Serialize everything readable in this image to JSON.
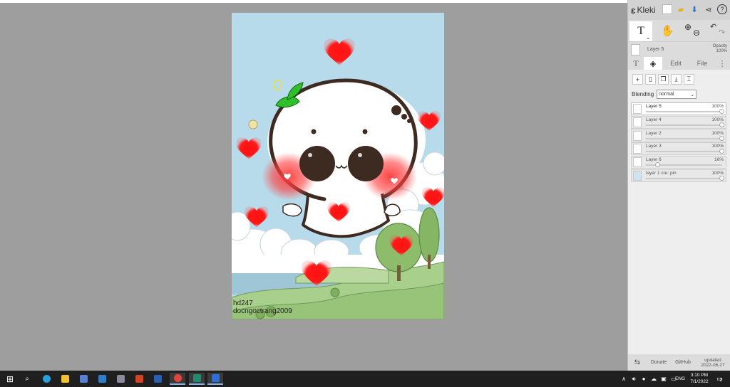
{
  "canvas": {
    "signature_line1": "hd247",
    "signature_line2": "docngoctrang2009"
  },
  "sidebar": {
    "app_name": "Kleki",
    "current_layer": {
      "name": "Layer 5",
      "opacity_label": "Opacity",
      "opacity_value": "100%"
    },
    "tabs": {
      "text": "T",
      "edit": "Edit",
      "file": "File",
      "more": "⋮"
    },
    "blending": {
      "label": "Blending",
      "value": "normal"
    },
    "layers": [
      {
        "name": "Layer 5",
        "opacity": "100%",
        "level": 1.0
      },
      {
        "name": "Layer 4",
        "opacity": "100%",
        "level": 1.0
      },
      {
        "name": "Layer 2",
        "opacity": "100%",
        "level": 1.0
      },
      {
        "name": "Layer 3",
        "opacity": "100%",
        "level": 1.0
      },
      {
        "name": "Layer 6",
        "opacity": "16%",
        "level": 0.16
      },
      {
        "name": "layer 1 cre: pin",
        "opacity": "100%",
        "level": 1.0
      }
    ],
    "footer": {
      "donate": "Donate",
      "github": "GitHub",
      "updated_label": "updated",
      "updated_date": "2022-06-27"
    }
  },
  "taskbar": {
    "language": "ENG",
    "time": "3:10 PM",
    "date": "7/1/2022",
    "notifications": "2"
  },
  "colors": {
    "canvas_sky": "#b7dbea",
    "workspace": "#9e9e9e",
    "sidebar": "#dcdcdc",
    "taskbar": "#1f1f1f",
    "heart": "#ff1a1a"
  }
}
